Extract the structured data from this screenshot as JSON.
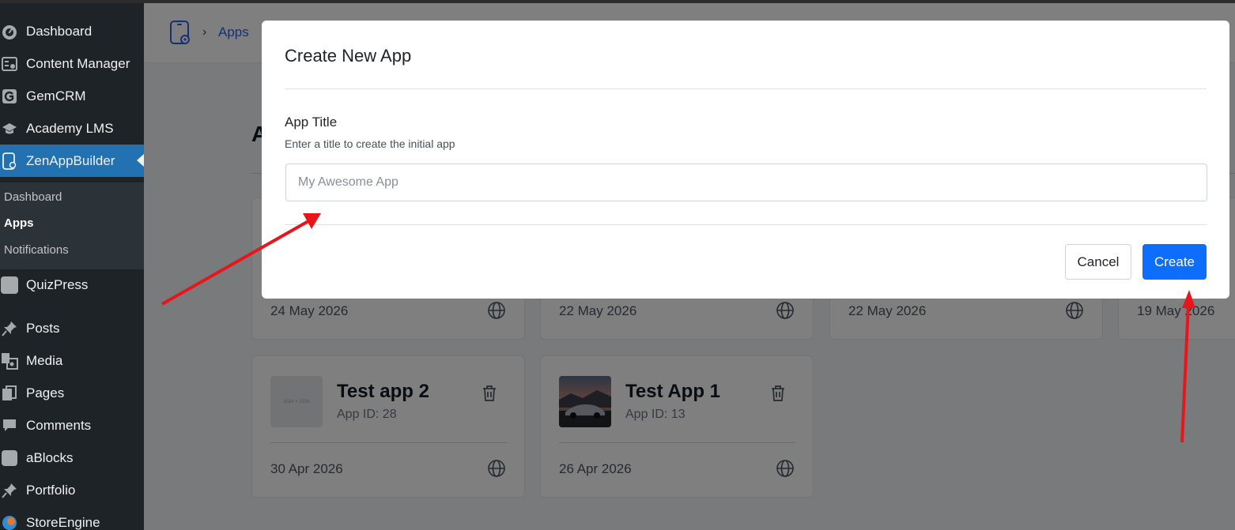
{
  "sidebar": {
    "items": [
      {
        "label": "Dashboard",
        "icon": "dashboard-icon"
      },
      {
        "label": "Content Manager",
        "icon": "content-manager-icon"
      },
      {
        "label": "GemCRM",
        "icon": "gemcrm-icon"
      },
      {
        "label": "Academy LMS",
        "icon": "graduation-cap-icon"
      },
      {
        "label": "ZenAppBuilder",
        "icon": "app-builder-icon",
        "active": true
      },
      {
        "label": "QuizPress",
        "icon": "quizpress-icon"
      },
      {
        "label": "Posts",
        "icon": "pin-icon"
      },
      {
        "label": "Media",
        "icon": "media-icon"
      },
      {
        "label": "Pages",
        "icon": "pages-icon"
      },
      {
        "label": "Comments",
        "icon": "comment-icon"
      },
      {
        "label": "aBlocks",
        "icon": "ablocks-icon"
      },
      {
        "label": "Portfolio",
        "icon": "pin-icon"
      },
      {
        "label": "StoreEngine",
        "icon": "storeengine-icon"
      }
    ],
    "submenu": [
      {
        "label": "Dashboard"
      },
      {
        "label": "Apps",
        "current": true
      },
      {
        "label": "Notifications"
      }
    ]
  },
  "breadcrumb": {
    "link": "Apps"
  },
  "page": {
    "heading_partial": "A"
  },
  "cards_top": [
    {
      "date": "24 May 2026"
    },
    {
      "date": "22 May 2026"
    },
    {
      "date": "22 May 2026"
    },
    {
      "date": "19 May 2026"
    }
  ],
  "cards": [
    {
      "title": "Test app 2",
      "app_id": "App ID: 28",
      "date": "30 Apr 2026",
      "thumb_text": "1024 × 1024"
    },
    {
      "title": "Test App 1",
      "app_id": "App ID: 13",
      "date": "26 Apr 2026"
    }
  ],
  "modal": {
    "title": "Create New App",
    "field_label": "App Title",
    "field_help": "Enter a title to create the initial app",
    "input_value": "",
    "input_placeholder": "My Awesome App",
    "cancel_label": "Cancel",
    "create_label": "Create"
  },
  "colors": {
    "sidebar_bg": "#1d2327",
    "sidebar_active": "#2271b1",
    "primary_button": "#0d6efd",
    "annotation_arrow": "#e8161b"
  }
}
